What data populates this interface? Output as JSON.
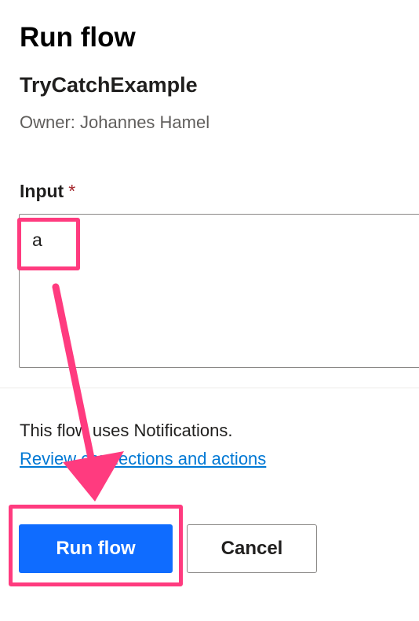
{
  "panel": {
    "title": "Run flow",
    "flow_name": "TryCatchExample",
    "owner": "Owner: Johannes Hamel"
  },
  "form": {
    "input_label": "Input",
    "required_marker": "*",
    "input_value": "a"
  },
  "notice": {
    "text": "This flow uses Notifications.",
    "link_text": "Review connections and actions"
  },
  "actions": {
    "run_label": "Run flow",
    "cancel_label": "Cancel"
  },
  "annotations": {
    "highlight_color": "#ff3b7f"
  }
}
